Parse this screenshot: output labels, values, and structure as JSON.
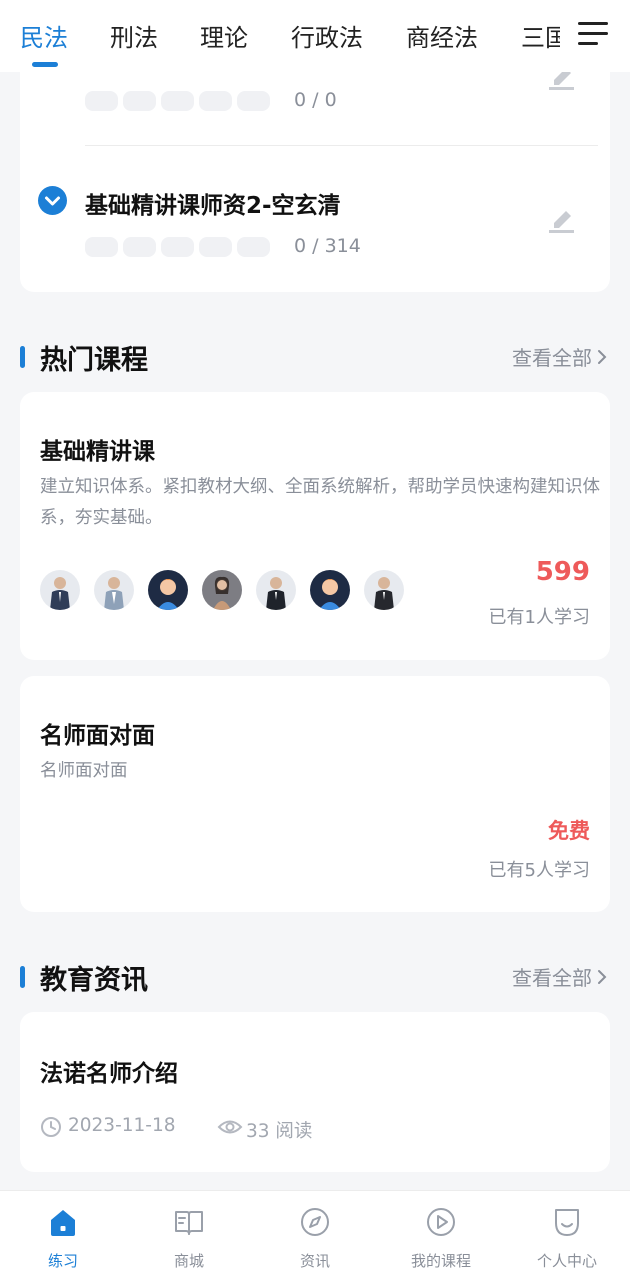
{
  "tabs": [
    "民法",
    "刑法",
    "理论",
    "行政法",
    "商经法",
    "三国法"
  ],
  "active_tab": 0,
  "chapters": [
    {
      "title": "",
      "progress": "0 / 0"
    },
    {
      "title": "基础精讲课师资2-空玄清",
      "progress": "0 / 314"
    }
  ],
  "hot_courses": {
    "title": "热门课程",
    "view_all": "查看全部",
    "items": [
      {
        "title": "基础精讲课",
        "desc": "建立知识体系。紧扣教材大纲、全面系统解析，帮助学员快速构建知识体系，夯实基础。",
        "price": "599",
        "learners": "已有1人学习"
      },
      {
        "title": "名师面对面",
        "desc": "名师面对面",
        "price": "免费",
        "learners": "已有5人学习"
      }
    ]
  },
  "news": {
    "title": "教育资讯",
    "view_all": "查看全部",
    "items": [
      {
        "title": "法诺名师介绍",
        "date": "2023-11-18",
        "reads": "33 阅读"
      }
    ]
  },
  "bottom_nav": [
    "练习",
    "商城",
    "资讯",
    "我的课程",
    "个人中心"
  ],
  "colors": {
    "accent": "#1c7fd6",
    "price": "#ee5a5a",
    "muted": "#8a8f99"
  }
}
